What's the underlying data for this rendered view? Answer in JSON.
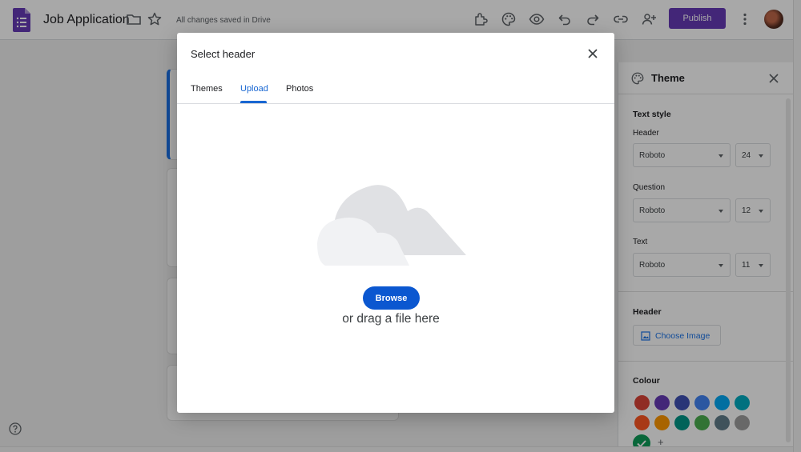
{
  "app": {
    "doc_title": "Job Application",
    "save_status": "All changes saved in Drive",
    "publish_label": "Publish"
  },
  "dialog": {
    "title": "Select header",
    "tabs": [
      {
        "label": "Themes",
        "active": false
      },
      {
        "label": "Upload",
        "active": true
      },
      {
        "label": "Photos",
        "active": false
      }
    ],
    "browse_label": "Browse",
    "drag_text": "or drag a file here"
  },
  "theme_panel": {
    "title": "Theme",
    "text_style_heading": "Text style",
    "header_label": "Header",
    "header_font": "Roboto",
    "header_size": "24",
    "question_label": "Question",
    "question_font": "Roboto",
    "question_size": "12",
    "text_label": "Text",
    "text_font": "Roboto",
    "text_size": "11",
    "header_section_heading": "Header",
    "choose_image_label": "Choose Image",
    "colour_heading": "Colour",
    "add_colour_symbol": "+",
    "colours": [
      "#db4437",
      "#673ab7",
      "#3f51b5",
      "#4285f4",
      "#03a9f4",
      "#00acc1",
      "#ff5722",
      "#ff9800",
      "#009688",
      "#4caf50",
      "#607d8b",
      "#9e9e9e",
      "#0f9d58"
    ],
    "selected_colour": "#0f9d58"
  },
  "colors": {
    "accent": "#673ab7",
    "link_blue": "#1967d2",
    "browse_blue": "#0b57d0"
  }
}
